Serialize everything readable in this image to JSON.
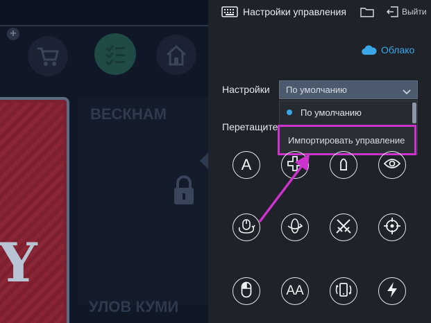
{
  "window": {
    "title": "Настройки управления",
    "exit_label": "Выйти"
  },
  "cloud": {
    "label": "Облако",
    "color": "#3aa7e8"
  },
  "settings": {
    "label": "Настройки",
    "selected_value": "По умолчанию",
    "options": [
      "По умолчанию",
      "Импортировать управление"
    ]
  },
  "hint": {
    "text": "Перетащите"
  },
  "annotation": {
    "highlight_color": "#cc33cc"
  },
  "controls": {
    "row1": [
      {
        "name": "text-input-button",
        "icon": "A-icon",
        "glyph": "A"
      },
      {
        "name": "dpad-button",
        "icon": "dpad-icon"
      },
      {
        "name": "bullet-button",
        "icon": "bullet-icon"
      },
      {
        "name": "view-button",
        "icon": "eye-icon"
      }
    ],
    "row2": [
      {
        "name": "mouse-rotate-button",
        "icon": "mouse-rotate-icon"
      },
      {
        "name": "rotate-view-button",
        "icon": "rotate-icon"
      },
      {
        "name": "swords-button",
        "icon": "crossed-swords-icon"
      },
      {
        "name": "crosshair-button",
        "icon": "crosshair-icon"
      }
    ],
    "row3": [
      {
        "name": "mouse-button",
        "icon": "mouse-icon"
      },
      {
        "name": "repeat-key-button",
        "icon": "AA-icon",
        "glyph": "AA"
      },
      {
        "name": "shake-button",
        "icon": "phone-shake-icon"
      },
      {
        "name": "macro-button",
        "icon": "lightning-icon"
      }
    ]
  }
}
